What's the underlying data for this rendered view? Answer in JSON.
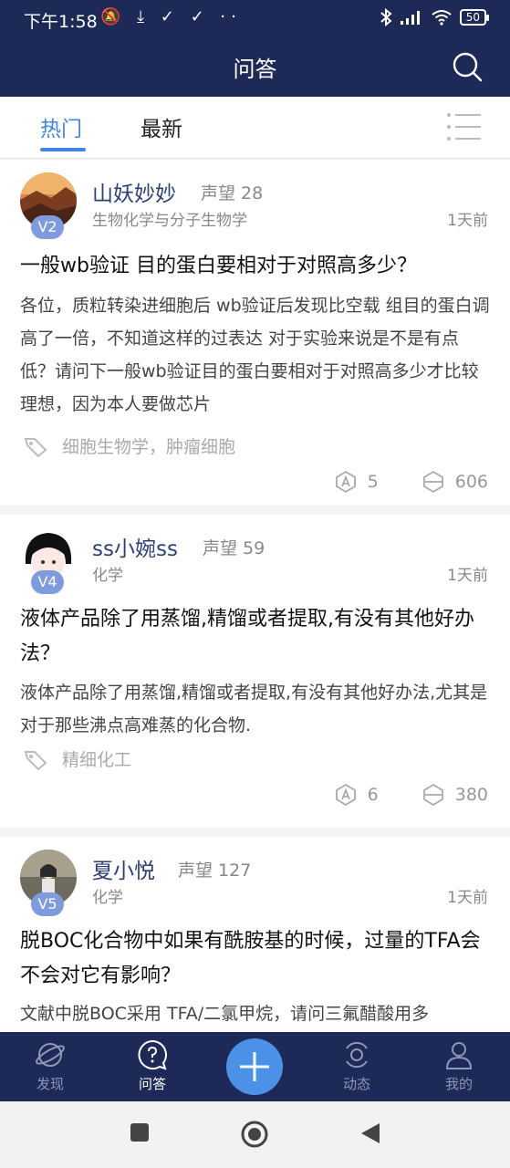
{
  "status_bar": {
    "time": "下午1:58",
    "icons": [
      "mute-icon",
      "download-icon",
      "check-icon",
      "check-icon",
      "more-dots-icon"
    ],
    "icon_glyphs": "🔕 ⤓ ✓ ✓ ··",
    "right_icons": [
      "bluetooth-icon",
      "signal-icon",
      "wifi-icon",
      "battery-icon"
    ],
    "battery": "50"
  },
  "header": {
    "title": "问答",
    "search_icon": "search-icon"
  },
  "tabs": [
    {
      "label": "热门",
      "active": true
    },
    {
      "label": "最新",
      "active": false
    }
  ],
  "posts": [
    {
      "user": "山妖妙妙",
      "level": "V2",
      "reputation": "声望 28",
      "field": "生物化学与分子生物学",
      "time": "1天前",
      "title": "一般wb验证 目的蛋白要相对于对照高多少？",
      "body": "各位，质粒转染进细胞后 wb验证后发现比空载 组目的蛋白调高了一倍，不知道这样的过表达 对于实验来说是不是有点低？请问下一般wb验证目的蛋白要相对于对照高多少才比较理想，因为本人要做芯片",
      "tags": "细胞生物学，肿瘤细胞",
      "answers": "5",
      "views": "606"
    },
    {
      "user": "ss小婉ss",
      "level": "V4",
      "reputation": "声望 59",
      "field": "化学",
      "time": "1天前",
      "title": "液体产品除了用蒸馏,精馏或者提取,有没有其他好办法？",
      "body": "液体产品除了用蒸馏,精馏或者提取,有没有其他好办法,尤其是对于那些沸点高难蒸的化合物.",
      "tags": "精细化工",
      "answers": "6",
      "views": "380"
    },
    {
      "user": "夏小悦",
      "level": "V5",
      "reputation": "声望 127",
      "field": "化学",
      "time": "1天前",
      "title": "脱BOC化合物中如果有酰胺基的时候，过量的TFA会不会对它有影响？",
      "body": "文献中脱BOC采用 TFA/二氯甲烷，请问三氟醋酸用多"
    }
  ],
  "bottom_nav": [
    {
      "label": "发现",
      "icon": "planet-icon",
      "active": false
    },
    {
      "label": "问答",
      "icon": "question-bubble-icon",
      "active": true
    },
    {
      "label": "",
      "icon": "plus-icon",
      "active": false
    },
    {
      "label": "动态",
      "icon": "signal-waves-icon",
      "active": false
    },
    {
      "label": "我的",
      "icon": "person-icon",
      "active": false
    }
  ],
  "colors": {
    "header_bg": "#1d2a57",
    "accent": "#3f86e6",
    "username": "#2d3f7a",
    "badge": "#7f9be0"
  }
}
